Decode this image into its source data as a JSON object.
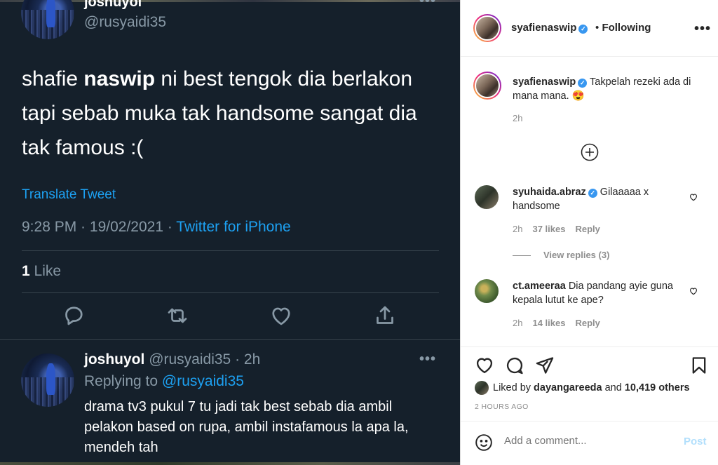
{
  "tweet": {
    "author_name": "joshuyol",
    "author_handle": "@rusyaidi35",
    "text_before": "shafie ",
    "text_bold": "naswip",
    "text_after": " ni best tengok dia berlakon tapi sebab muka tak handsome sangat dia tak famous :(",
    "translate_label": "Translate Tweet",
    "time": "9:28 PM",
    "date": "19/02/2021",
    "source": "Twitter for iPhone",
    "likes_count": "1",
    "likes_label": "Like",
    "actions": [
      "reply-icon",
      "retweet-icon",
      "like-icon",
      "share-icon"
    ]
  },
  "reply": {
    "author_name": "joshuyol",
    "author_handle": "@rusyaidi35",
    "age": "2h",
    "replying_prefix": "Replying to",
    "replying_to": "@rusyaidi35",
    "text": "drama tv3 pukul 7 tu jadi tak best sebab dia ambil pelakon based on rupa, ambil instafamous la apa la, mendeh tah"
  },
  "instagram": {
    "header": {
      "username": "syafienaswip",
      "follow_status": "Following",
      "separator": "•"
    },
    "caption": {
      "username": "syafienaswip",
      "text": "Takpelah rezeki ada di mana mana. 😍",
      "age": "2h"
    },
    "comments": [
      {
        "username": "syuhaida.abraz",
        "text": "Gilaaaaa x handsome",
        "age": "2h",
        "likes": "37 likes",
        "reply_label": "Reply",
        "view_replies": "View replies (3)"
      },
      {
        "username": "ct.ameeraa",
        "text": "Dia pandang ayie guna kepala lutut ke ape?",
        "age": "2h",
        "likes": "14 likes",
        "reply_label": "Reply"
      }
    ],
    "liked_by_prefix": "Liked by",
    "liked_by_user": "dayangareeda",
    "liked_by_and": "and",
    "liked_by_others": "10,419 others",
    "timestamp": "2 HOURS AGO",
    "comment_placeholder": "Add a comment...",
    "post_label": "Post",
    "accent_color": "#3897f0",
    "post_disabled_color": "#b2dffc"
  },
  "colors": {
    "twitter_bg": "#15202b",
    "twitter_blue": "#1da1f2",
    "twitter_muted": "#8899a6"
  }
}
